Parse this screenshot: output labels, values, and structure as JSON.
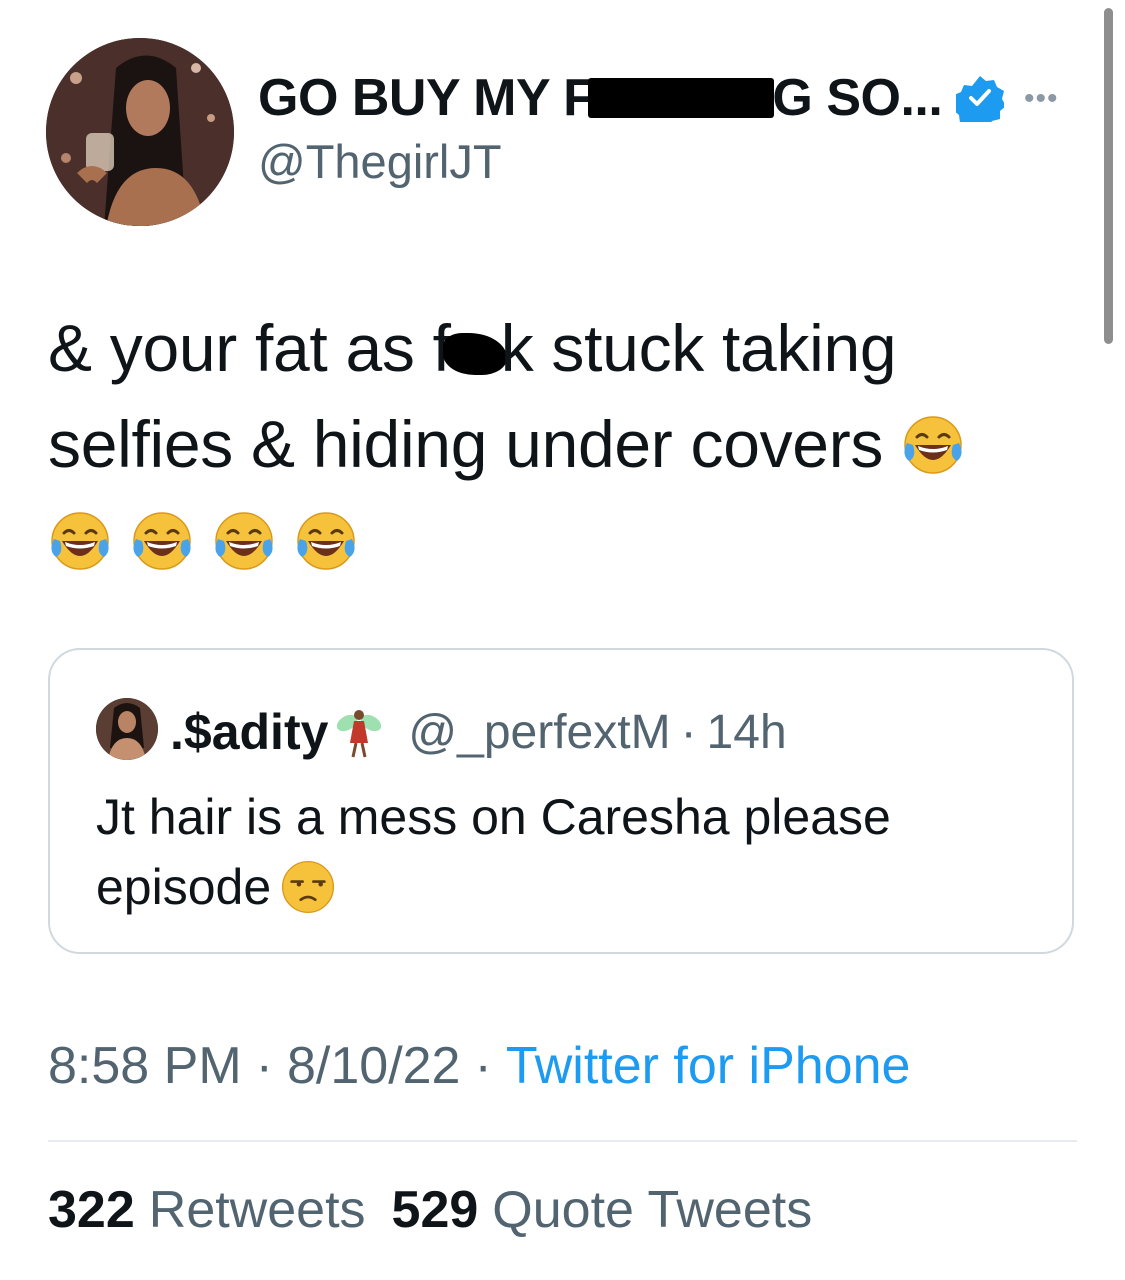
{
  "author": {
    "display_name_start": "GO BUY MY F",
    "display_name_end": "G SO...",
    "handle": "@ThegirlJT",
    "verified": true
  },
  "tweet": {
    "line1_start": "& your fat as f",
    "line1_end": "k stuck taking",
    "line2": "selfies & hiding under covers"
  },
  "quote": {
    "display_name": ".$adity",
    "handle": "@_perfextM",
    "separator": "·",
    "time": "14h",
    "text": "Jt hair is a mess on Caresha please episode"
  },
  "meta": {
    "time": "8:58 PM",
    "separator": "·",
    "date": "8/10/22",
    "source": "Twitter for iPhone"
  },
  "stats": {
    "retweets_count": "322",
    "retweets_label": "Retweets",
    "quotes_count": "529",
    "quotes_label": "Quote Tweets"
  },
  "icons": {
    "verified": "verified-badge-icon",
    "more": "more-icon",
    "laughing": "face-with-tears-of-joy-emoji",
    "unamused": "unamused-face-emoji",
    "fairy": "fairy-emoji"
  },
  "colors": {
    "accent": "#1d9bf0",
    "secondary_text": "#536471",
    "border": "#cfd9de"
  }
}
